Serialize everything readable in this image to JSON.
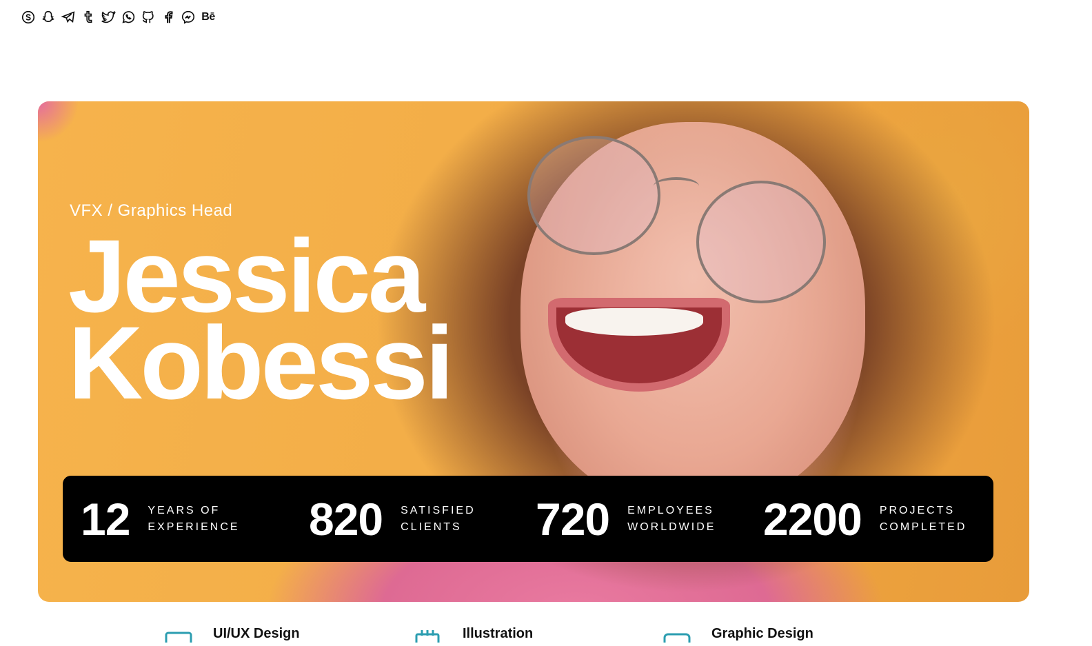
{
  "social_links": [
    {
      "icon": "skype-icon"
    },
    {
      "icon": "snapchat-icon"
    },
    {
      "icon": "telegram-icon"
    },
    {
      "icon": "tumblr-icon"
    },
    {
      "icon": "twitter-icon"
    },
    {
      "icon": "whatsapp-icon"
    },
    {
      "icon": "github-icon"
    },
    {
      "icon": "facebook-icon"
    },
    {
      "icon": "messenger-icon"
    },
    {
      "icon": "behance-icon",
      "text": "Bē"
    }
  ],
  "hero": {
    "role": "VFX / Graphics Head",
    "first_name": "Jessica",
    "last_name": "Kobessi"
  },
  "stats": [
    {
      "value": "12",
      "label_line1": "Years of",
      "label_line2": "Experience"
    },
    {
      "value": "820",
      "label_line1": "Satisfied",
      "label_line2": "Clients"
    },
    {
      "value": "720",
      "label_line1": "Employees",
      "label_line2": "Worldwide"
    },
    {
      "value": "2200",
      "label_line1": "Projects",
      "label_line2": "Completed"
    }
  ],
  "services": [
    {
      "title": "UI/UX Design",
      "icon": "monitor-icon"
    },
    {
      "title": "Illustration",
      "icon": "calendar-icon"
    },
    {
      "title": "Graphic Design",
      "icon": "monitor-icon"
    }
  ],
  "colors": {
    "hero_background": "#f3ae48",
    "stats_bar": "#000000",
    "service_icon": "#2b9db0"
  }
}
